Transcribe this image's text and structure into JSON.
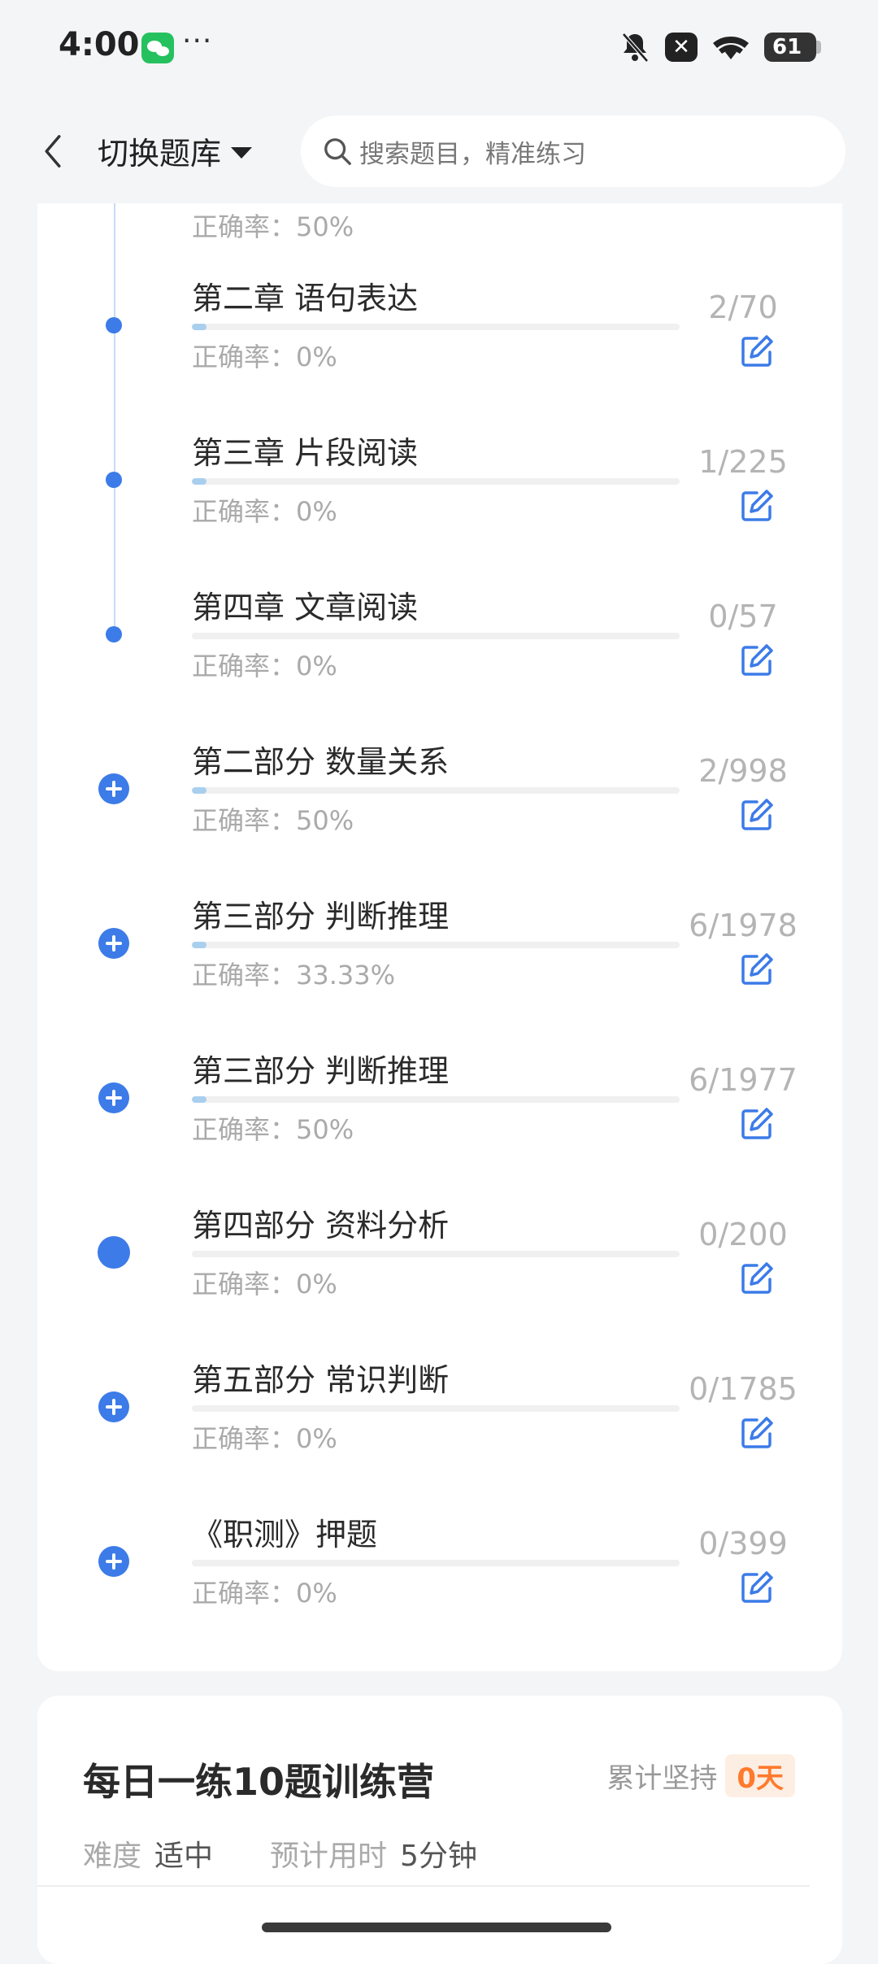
{
  "status_bar": {
    "time": "4:00",
    "dots": "···",
    "battery": "61"
  },
  "nav": {
    "switch_label": "切换题库",
    "search_placeholder": "搜索题目，精准练习"
  },
  "partial_row": {
    "accuracy": "正确率：50%"
  },
  "rows": [
    {
      "title": "第二章 语句表达",
      "accuracy": "正确率：0%",
      "count": "2/70",
      "progress": 0.029,
      "marker": "dot"
    },
    {
      "title": "第三章 片段阅读",
      "accuracy": "正确率：0%",
      "count": "1/225",
      "progress": 0.004,
      "marker": "dot"
    },
    {
      "title": "第四章 文章阅读",
      "accuracy": "正确率：0%",
      "count": "0/57",
      "progress": 0,
      "marker": "dot"
    },
    {
      "title": "第二部分 数量关系",
      "accuracy": "正确率：50%",
      "count": "2/998",
      "progress": 0.002,
      "marker": "plus"
    },
    {
      "title": "第三部分 判断推理",
      "accuracy": "正确率：33.33%",
      "count": "6/1978",
      "progress": 0.003,
      "marker": "plus"
    },
    {
      "title": "第三部分 判断推理",
      "accuracy": "正确率：50%",
      "count": "6/1977",
      "progress": 0.003,
      "marker": "plus"
    },
    {
      "title": "第四部分 资料分析",
      "accuracy": "正确率：0%",
      "count": "0/200",
      "progress": 0,
      "marker": "bigdot"
    },
    {
      "title": "第五部分 常识判断",
      "accuracy": "正确率：0%",
      "count": "0/1785",
      "progress": 0,
      "marker": "plus"
    },
    {
      "title": "《职测》押题",
      "accuracy": "正确率：0%",
      "count": "0/399",
      "progress": 0,
      "marker": "plus"
    }
  ],
  "camp": {
    "title": "每日一练10题训练营",
    "persist_label": "累计坚持",
    "persist_days": "0天",
    "difficulty_label": "难度",
    "difficulty_value": "适中",
    "time_label": "预计用时",
    "time_value": "5分钟"
  },
  "colors": {
    "accent": "#3c7be8",
    "badge_text": "#ff7a2d",
    "badge_bg": "#fdeee3"
  }
}
